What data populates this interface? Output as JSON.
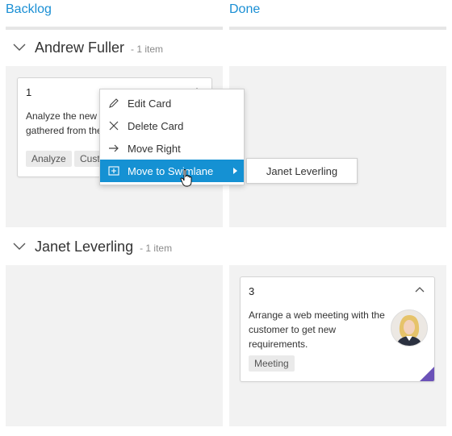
{
  "columns": {
    "backlog": "Backlog",
    "done": "Done"
  },
  "swimlanes": [
    {
      "name": "Andrew Fuller",
      "count": "- 1 item"
    },
    {
      "name": "Janet Leverling",
      "count": "- 1 item"
    }
  ],
  "cards": {
    "card1": {
      "id": "1",
      "text_line1": "Analyze the new r",
      "text_line2": "gathered from the",
      "tags": [
        "Analyze",
        "Custo"
      ]
    },
    "card3": {
      "id": "3",
      "text_line1": "Arrange a web meeting with the",
      "text_line2": "customer to get new",
      "text_line3": "requirements.",
      "tags": [
        "Meeting"
      ]
    }
  },
  "context_menu": {
    "items": [
      {
        "label": "Edit Card",
        "icon": "pencil-icon"
      },
      {
        "label": "Delete Card",
        "icon": "close-icon"
      },
      {
        "label": "Move Right",
        "icon": "arrow-right-icon"
      },
      {
        "label": "Move to Swimlane",
        "icon": "move-icon"
      }
    ]
  },
  "submenu": {
    "items": [
      "Janet Leverling"
    ]
  },
  "colors": {
    "accent": "#1591d3",
    "header_text": "#1a8fd4",
    "card_corner": "#6b52b8",
    "lane_bg": "#f2f2f2"
  }
}
